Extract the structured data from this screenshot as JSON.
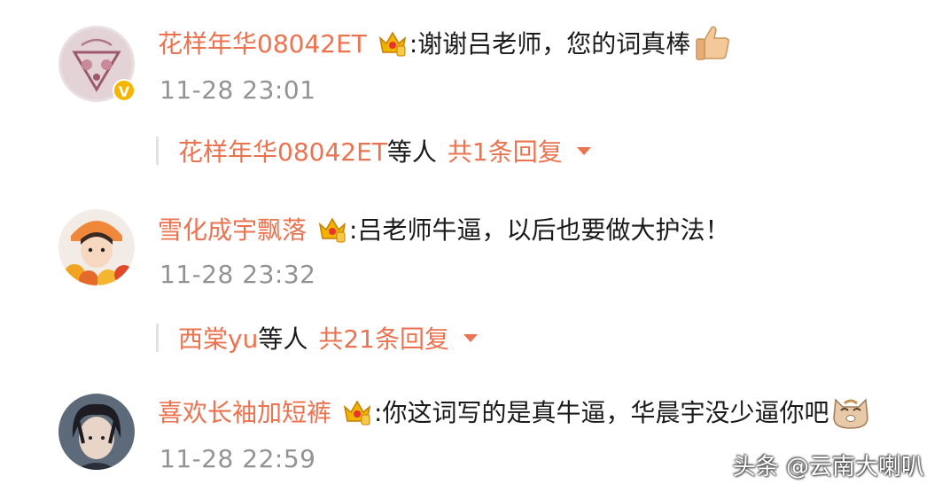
{
  "comments": [
    {
      "username": "花样年华08042ET",
      "text": ":谢谢吕老师，您的词真棒",
      "emoji": "thumbs-up-icon",
      "time": "11-28 23:01",
      "verified": true,
      "reply": {
        "user": "花样年华08042ET",
        "mid": " 等人",
        "count": "共1条回复"
      }
    },
    {
      "username": "雪化成宇飘落",
      "text": ":吕老师牛逼，以后也要做大护法！",
      "emoji": "",
      "time": "11-28 23:32",
      "verified": false,
      "reply": {
        "user": "西棠yu",
        "mid": " 等人",
        "count": "共21条回复"
      }
    },
    {
      "username": "喜欢长袖加短裤",
      "text": ":你这词写的是真牛逼，华晨宇没少逼你吧",
      "emoji": "cat-face-icon",
      "time": "11-28 22:59",
      "verified": false
    }
  ],
  "watermark": "头条 @云南大喇叭",
  "colors": {
    "username": "#eb7350",
    "time": "#939393",
    "text": "#1a1a1a"
  }
}
